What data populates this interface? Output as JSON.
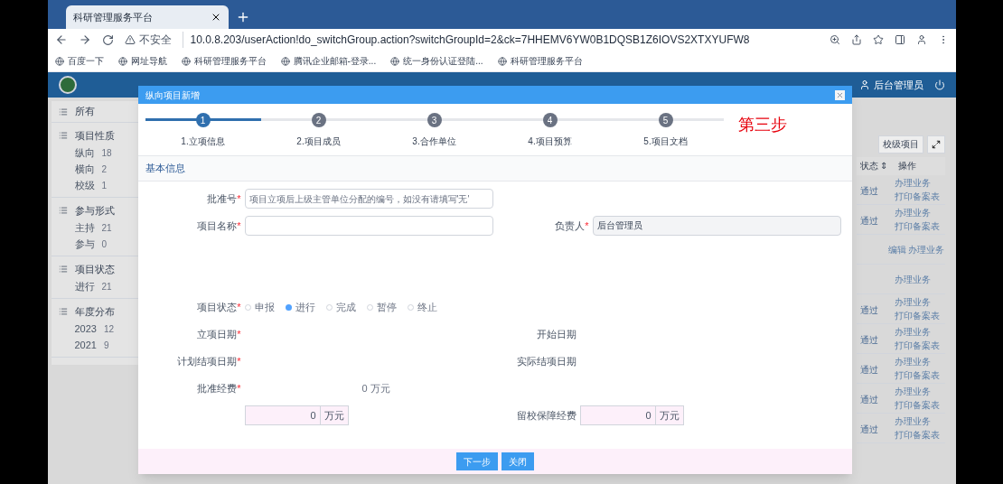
{
  "browser": {
    "tab_title": "科研管理服务平台",
    "security": "不安全",
    "url": "10.0.8.203/userAction!do_switchGroup.action?switchGroupId=2&ck=7HHEMV6YW0B1DQSB1Z6IOVS2XTXYUFW8",
    "bookmarks": [
      "百度一下",
      "网址导航",
      "科研管理服务平台",
      "腾讯企业邮箱-登录...",
      "统一身份认证登陆...",
      "科研管理服务平台"
    ]
  },
  "header": {
    "user": "后台管理员"
  },
  "sidebar": {
    "all": "所有",
    "groups": [
      {
        "title": "项目性质",
        "items": [
          {
            "label": "纵向",
            "count": "18"
          },
          {
            "label": "横向",
            "count": "2"
          },
          {
            "label": "校级",
            "count": "1"
          }
        ]
      },
      {
        "title": "参与形式",
        "items": [
          {
            "label": "主持",
            "count": "21"
          },
          {
            "label": "参与",
            "count": "0"
          }
        ]
      },
      {
        "title": "项目状态",
        "items": [
          {
            "label": "进行",
            "count": "21"
          }
        ]
      },
      {
        "title": "年度分布",
        "items": [
          {
            "label": "2023",
            "count": "12"
          },
          {
            "label": "2021",
            "count": "9"
          }
        ]
      }
    ]
  },
  "table": {
    "toolbar_button": "校级项目",
    "columns": [
      "状态 ⇕",
      "操作"
    ],
    "rows": [
      {
        "status": "通过",
        "actions": [
          "办理业务",
          "打印备案表"
        ]
      },
      {
        "status": "通过",
        "actions": [
          "办理业务",
          "打印备案表"
        ]
      },
      {
        "status": "",
        "actions": [
          "编辑 办理业务"
        ]
      },
      {
        "status": "",
        "actions": [
          "办理业务"
        ]
      },
      {
        "status": "通过",
        "actions": [
          "办理业务",
          "打印备案表"
        ]
      },
      {
        "status": "通过",
        "actions": [
          "办理业务",
          "打印备案表"
        ]
      },
      {
        "status": "通过",
        "actions": [
          "办理业务",
          "打印备案表"
        ]
      },
      {
        "status": "通过",
        "actions": [
          "办理业务",
          "打印备案表"
        ]
      },
      {
        "status": "通过",
        "actions": [
          "办理业务",
          "打印备案表"
        ]
      }
    ]
  },
  "modal": {
    "title": "纵向项目新增",
    "steps": [
      {
        "number": "1",
        "label": "1.立项信息",
        "selected": true
      },
      {
        "number": "2",
        "label": "2.项目成员",
        "selected": false
      },
      {
        "number": "3",
        "label": "3.合作单位",
        "selected": false
      },
      {
        "number": "4",
        "label": "4.项目预算",
        "selected": false
      },
      {
        "number": "5",
        "label": "5.项目文档",
        "selected": false
      }
    ],
    "annotation": "第三步",
    "section": "基本信息",
    "rows": [
      {
        "left": {
          "kind": "input",
          "label": "批准号",
          "mark": "*",
          "placeholder": "项目立项后上级主管单位分配的编号，如没有请填写'无'"
        }
      },
      {
        "left": {
          "kind": "input",
          "label": "项目名称",
          "mark": "*"
        },
        "right": {
          "kind": "input",
          "label": "负责人",
          "mark": "*",
          "value": "后台管理员",
          "disabled": true
        }
      },
      {
        "left": {
          "kind": "radio",
          "label": "项目状态",
          "mark": "*",
          "options": [
            {
              "label": "申报",
              "selected": false
            },
            {
              "label": "进行",
              "selected": true
            },
            {
              "label": "完成",
              "selected": false
            },
            {
              "label": "暂停",
              "selected": false
            },
            {
              "label": "终止",
              "selected": false
            }
          ]
        }
      },
      {
        "left": {
          "kind": "text",
          "label": "立项日期",
          "mark": "*"
        },
        "right": {
          "kind": "text",
          "label": "开始日期"
        }
      },
      {
        "left": {
          "kind": "text",
          "label": "计划结项日期",
          "mark": "*"
        },
        "right": {
          "kind": "text",
          "label": "实际结项日期"
        }
      },
      {
        "left": {
          "kind": "amount_text",
          "label": "批准经费",
          "mark": "*",
          "value": "0",
          "unit": "万元"
        }
      },
      {
        "left": {
          "kind": "money",
          "value": "0",
          "unit": "万元"
        },
        "right": {
          "kind": "money",
          "label": "留校保障经费",
          "value": "0",
          "unit": "万元"
        }
      }
    ],
    "buttons": [
      "下一步",
      "关闭"
    ]
  }
}
